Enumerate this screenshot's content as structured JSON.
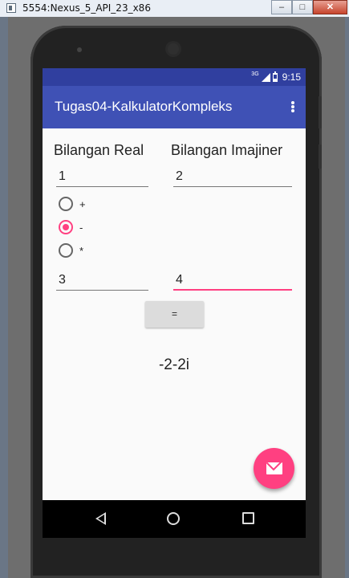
{
  "window": {
    "title": "5554:Nexus_5_API_23_x86",
    "minimize_label": "–",
    "maximize_label": "□",
    "close_label": "✕"
  },
  "status_bar": {
    "network_label": "3G",
    "time": "9:15"
  },
  "app_bar": {
    "title": "Tugas04-KalkulatorKompleks"
  },
  "form": {
    "real_header": "Bilangan Real",
    "imaginary_header": "Bilangan Imajiner",
    "first_real_value": "1",
    "first_imaginary_value": "2",
    "operators": [
      {
        "label": "+",
        "checked": false
      },
      {
        "label": "-",
        "checked": true
      },
      {
        "label": "*",
        "checked": false
      }
    ],
    "second_real_value": "3",
    "second_imaginary_value": "4",
    "equals_label": "=",
    "result": "-2-2i"
  },
  "colors": {
    "primary": "#3f51b5",
    "primary_dark": "#303f9f",
    "accent": "#ff4081"
  },
  "icons": {
    "fab": "mail-icon",
    "nav_back": "back-icon",
    "nav_home": "home-icon",
    "nav_recent": "recent-apps-icon",
    "overflow": "more-vert-icon"
  }
}
